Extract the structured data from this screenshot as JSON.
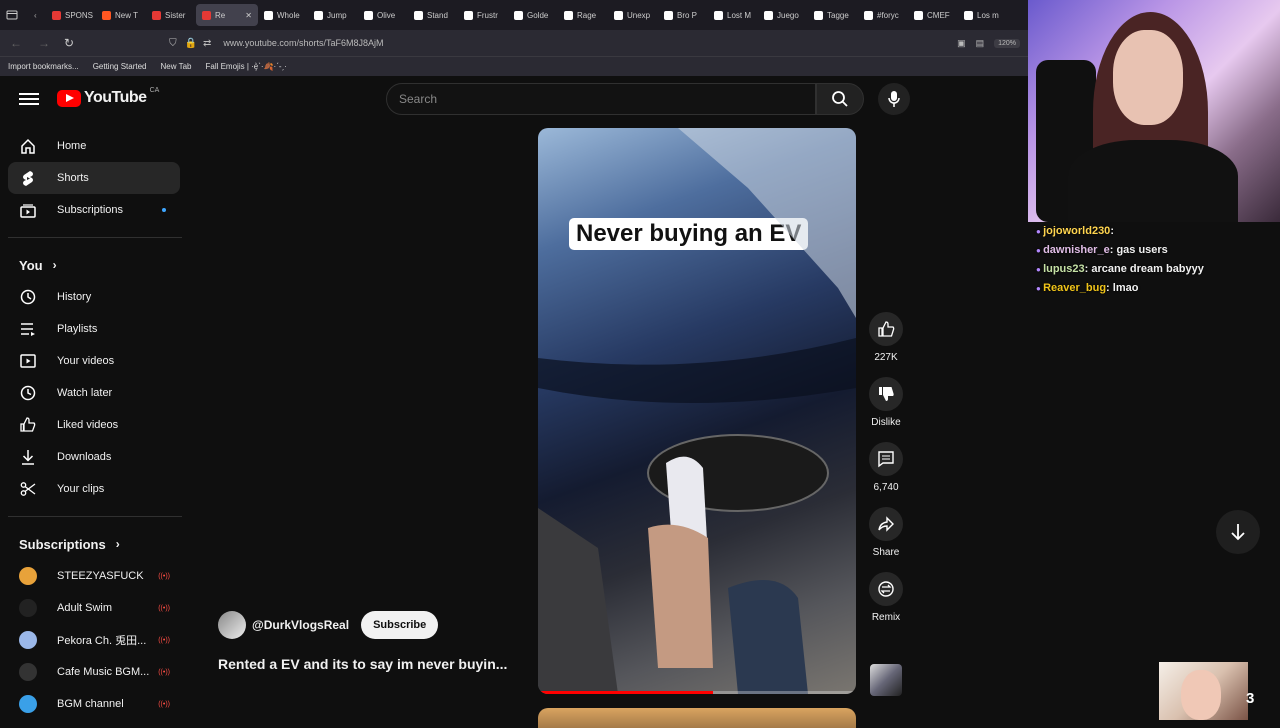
{
  "browser": {
    "tabs": [
      {
        "label": "SPONS",
        "color": "#e53935"
      },
      {
        "label": "New T",
        "color": "#ff5722"
      },
      {
        "label": "Sister",
        "color": "#e53935"
      },
      {
        "label": "Re",
        "color": "#e53935",
        "active": true
      },
      {
        "label": "Whole",
        "color": "#ffffff"
      },
      {
        "label": "Jump",
        "color": "#ffffff"
      },
      {
        "label": "Olive",
        "color": "#ffffff"
      },
      {
        "label": "Stand",
        "color": "#ffffff"
      },
      {
        "label": "Frustr",
        "color": "#ffffff"
      },
      {
        "label": "Golde",
        "color": "#ffffff"
      },
      {
        "label": "Rage",
        "color": "#ffffff"
      },
      {
        "label": "Unexp",
        "color": "#ffffff"
      },
      {
        "label": "Bro P",
        "color": "#ffffff"
      },
      {
        "label": "Lost M",
        "color": "#ffffff"
      },
      {
        "label": "Juego",
        "color": "#ffffff"
      },
      {
        "label": "Tagge",
        "color": "#ffffff"
      },
      {
        "label": "#foryc",
        "color": "#ffffff"
      },
      {
        "label": "CMEF",
        "color": "#ffffff"
      },
      {
        "label": "Los m",
        "color": "#ffffff"
      }
    ],
    "url": "www.youtube.com/shorts/TaF6M8J8AjM",
    "zoom": "120%",
    "bookmarks": [
      "Import bookmarks...",
      "Getting Started",
      "New Tab",
      "Fall Emojis | ·ȩ̀ˋ·🍂·ˊ-ˏ·"
    ]
  },
  "header": {
    "logo_text": "YouTube",
    "country": "CA",
    "search_placeholder": "Search"
  },
  "sidebar": {
    "main": [
      {
        "label": "Home",
        "icon": "home-icon"
      },
      {
        "label": "Shorts",
        "icon": "shorts-icon",
        "active": true
      },
      {
        "label": "Subscriptions",
        "icon": "subscriptions-icon",
        "dot": true
      }
    ],
    "you_heading": "You",
    "you": [
      {
        "label": "History",
        "icon": "history-icon"
      },
      {
        "label": "Playlists",
        "icon": "playlists-icon"
      },
      {
        "label": "Your videos",
        "icon": "your-videos-icon"
      },
      {
        "label": "Watch later",
        "icon": "watch-later-icon"
      },
      {
        "label": "Liked videos",
        "icon": "liked-videos-icon"
      },
      {
        "label": "Downloads",
        "icon": "downloads-icon"
      },
      {
        "label": "Your clips",
        "icon": "clips-icon"
      }
    ],
    "subs_heading": "Subscriptions",
    "subscriptions": [
      {
        "label": "STEEZYASFUCK",
        "color": "#e8a23a"
      },
      {
        "label": "Adult Swim",
        "color": "#222222"
      },
      {
        "label": "Pekora Ch. 兎田...",
        "color": "#9ab7e8"
      },
      {
        "label": "Cafe Music BGM...",
        "color": "#333333"
      },
      {
        "label": "BGM channel",
        "color": "#3aa0e8"
      }
    ],
    "live_indicator": "((•))"
  },
  "short": {
    "overlay_text": "Never buying an EV",
    "progress": 0.55,
    "channel": "@DurkVlogsReal",
    "subscribe": "Subscribe",
    "title": "Rented a EV and its to say im never buyin...",
    "actions": [
      {
        "name": "like",
        "icon": "thumbs-up-icon",
        "label": "227K"
      },
      {
        "name": "dislike",
        "icon": "thumbs-down-icon",
        "label": "Dislike"
      },
      {
        "name": "comments",
        "icon": "comment-icon",
        "label": "6,740"
      },
      {
        "name": "share",
        "icon": "share-icon",
        "label": "Share"
      },
      {
        "name": "remix",
        "icon": "remix-icon",
        "label": "Remix"
      }
    ]
  },
  "stream_chat": [
    {
      "user": "jojoworld230",
      "msg": "",
      "color": "#ffd54f"
    },
    {
      "user": "dawnisher_e",
      "msg": "gas users",
      "color": "#e1bee7"
    },
    {
      "user": "lupus23",
      "msg": "arcane dream babyyy",
      "color": "#c5e1a5"
    },
    {
      "user": "Reaver_bug",
      "msg": "lmao",
      "color": "#f0c419"
    }
  ],
  "mini_cam_number": "3"
}
